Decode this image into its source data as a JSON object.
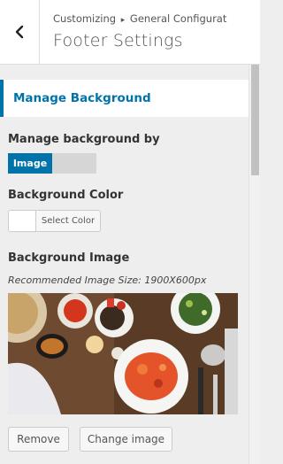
{
  "header": {
    "breadcrumb_root": "Customizing",
    "breadcrumb_separator": "▸",
    "breadcrumb_current": "General Configurat",
    "title": "Footer Settings"
  },
  "section": {
    "title": "Manage Background"
  },
  "manage_by": {
    "label": "Manage background by",
    "options": [
      "Image",
      ""
    ],
    "selected": "Image"
  },
  "bg_color": {
    "label": "Background Color",
    "button_label": "Select Color",
    "value": "#ffffff"
  },
  "bg_image": {
    "label": "Background Image",
    "description": "Recommended Image Size: 1900X600px",
    "remove_label": "Remove",
    "change_label": "Change image"
  },
  "colors": {
    "accent": "#0073aa"
  }
}
